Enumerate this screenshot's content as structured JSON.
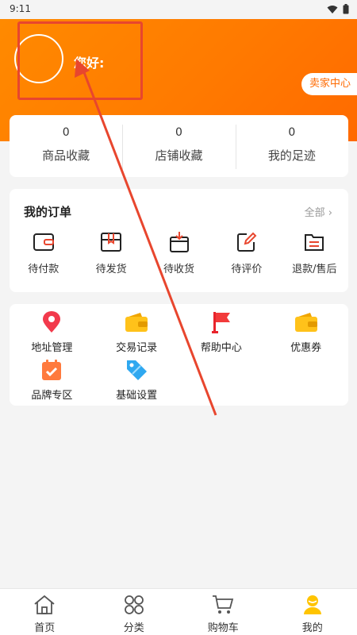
{
  "status_bar": {
    "time": "9:11"
  },
  "header": {
    "greeting": "您好:",
    "seller_center": "卖家中心"
  },
  "stats": [
    {
      "count": "0",
      "label": "商品收藏"
    },
    {
      "count": "0",
      "label": "店铺收藏"
    },
    {
      "count": "0",
      "label": "我的足迹"
    }
  ],
  "orders": {
    "title": "我的订单",
    "all_label": "全部",
    "items": [
      {
        "label": "待付款",
        "icon": "wallet-icon"
      },
      {
        "label": "待发货",
        "icon": "package-icon"
      },
      {
        "label": "待收货",
        "icon": "receive-box-icon"
      },
      {
        "label": "待评价",
        "icon": "edit-review-icon"
      },
      {
        "label": "退款/售后",
        "icon": "refund-folder-icon"
      }
    ]
  },
  "tools": [
    {
      "label": "地址管理",
      "icon": "location-pin-icon"
    },
    {
      "label": "交易记录",
      "icon": "wallet-yellow-icon"
    },
    {
      "label": "帮助中心",
      "icon": "flag-icon"
    },
    {
      "label": "优惠券",
      "icon": "coupon-icon"
    },
    {
      "label": "品牌专区",
      "icon": "calendar-check-icon"
    },
    {
      "label": "基础设置",
      "icon": "price-tag-icon"
    }
  ],
  "tabbar": [
    {
      "label": "首页",
      "icon": "home-icon"
    },
    {
      "label": "分类",
      "icon": "category-icon"
    },
    {
      "label": "购物车",
      "icon": "cart-icon"
    },
    {
      "label": "我的",
      "icon": "user-icon",
      "active": true
    }
  ],
  "colors": {
    "brand": "#ff7a00",
    "annotation": "#e8462e",
    "active_tab": "#ffc400"
  }
}
